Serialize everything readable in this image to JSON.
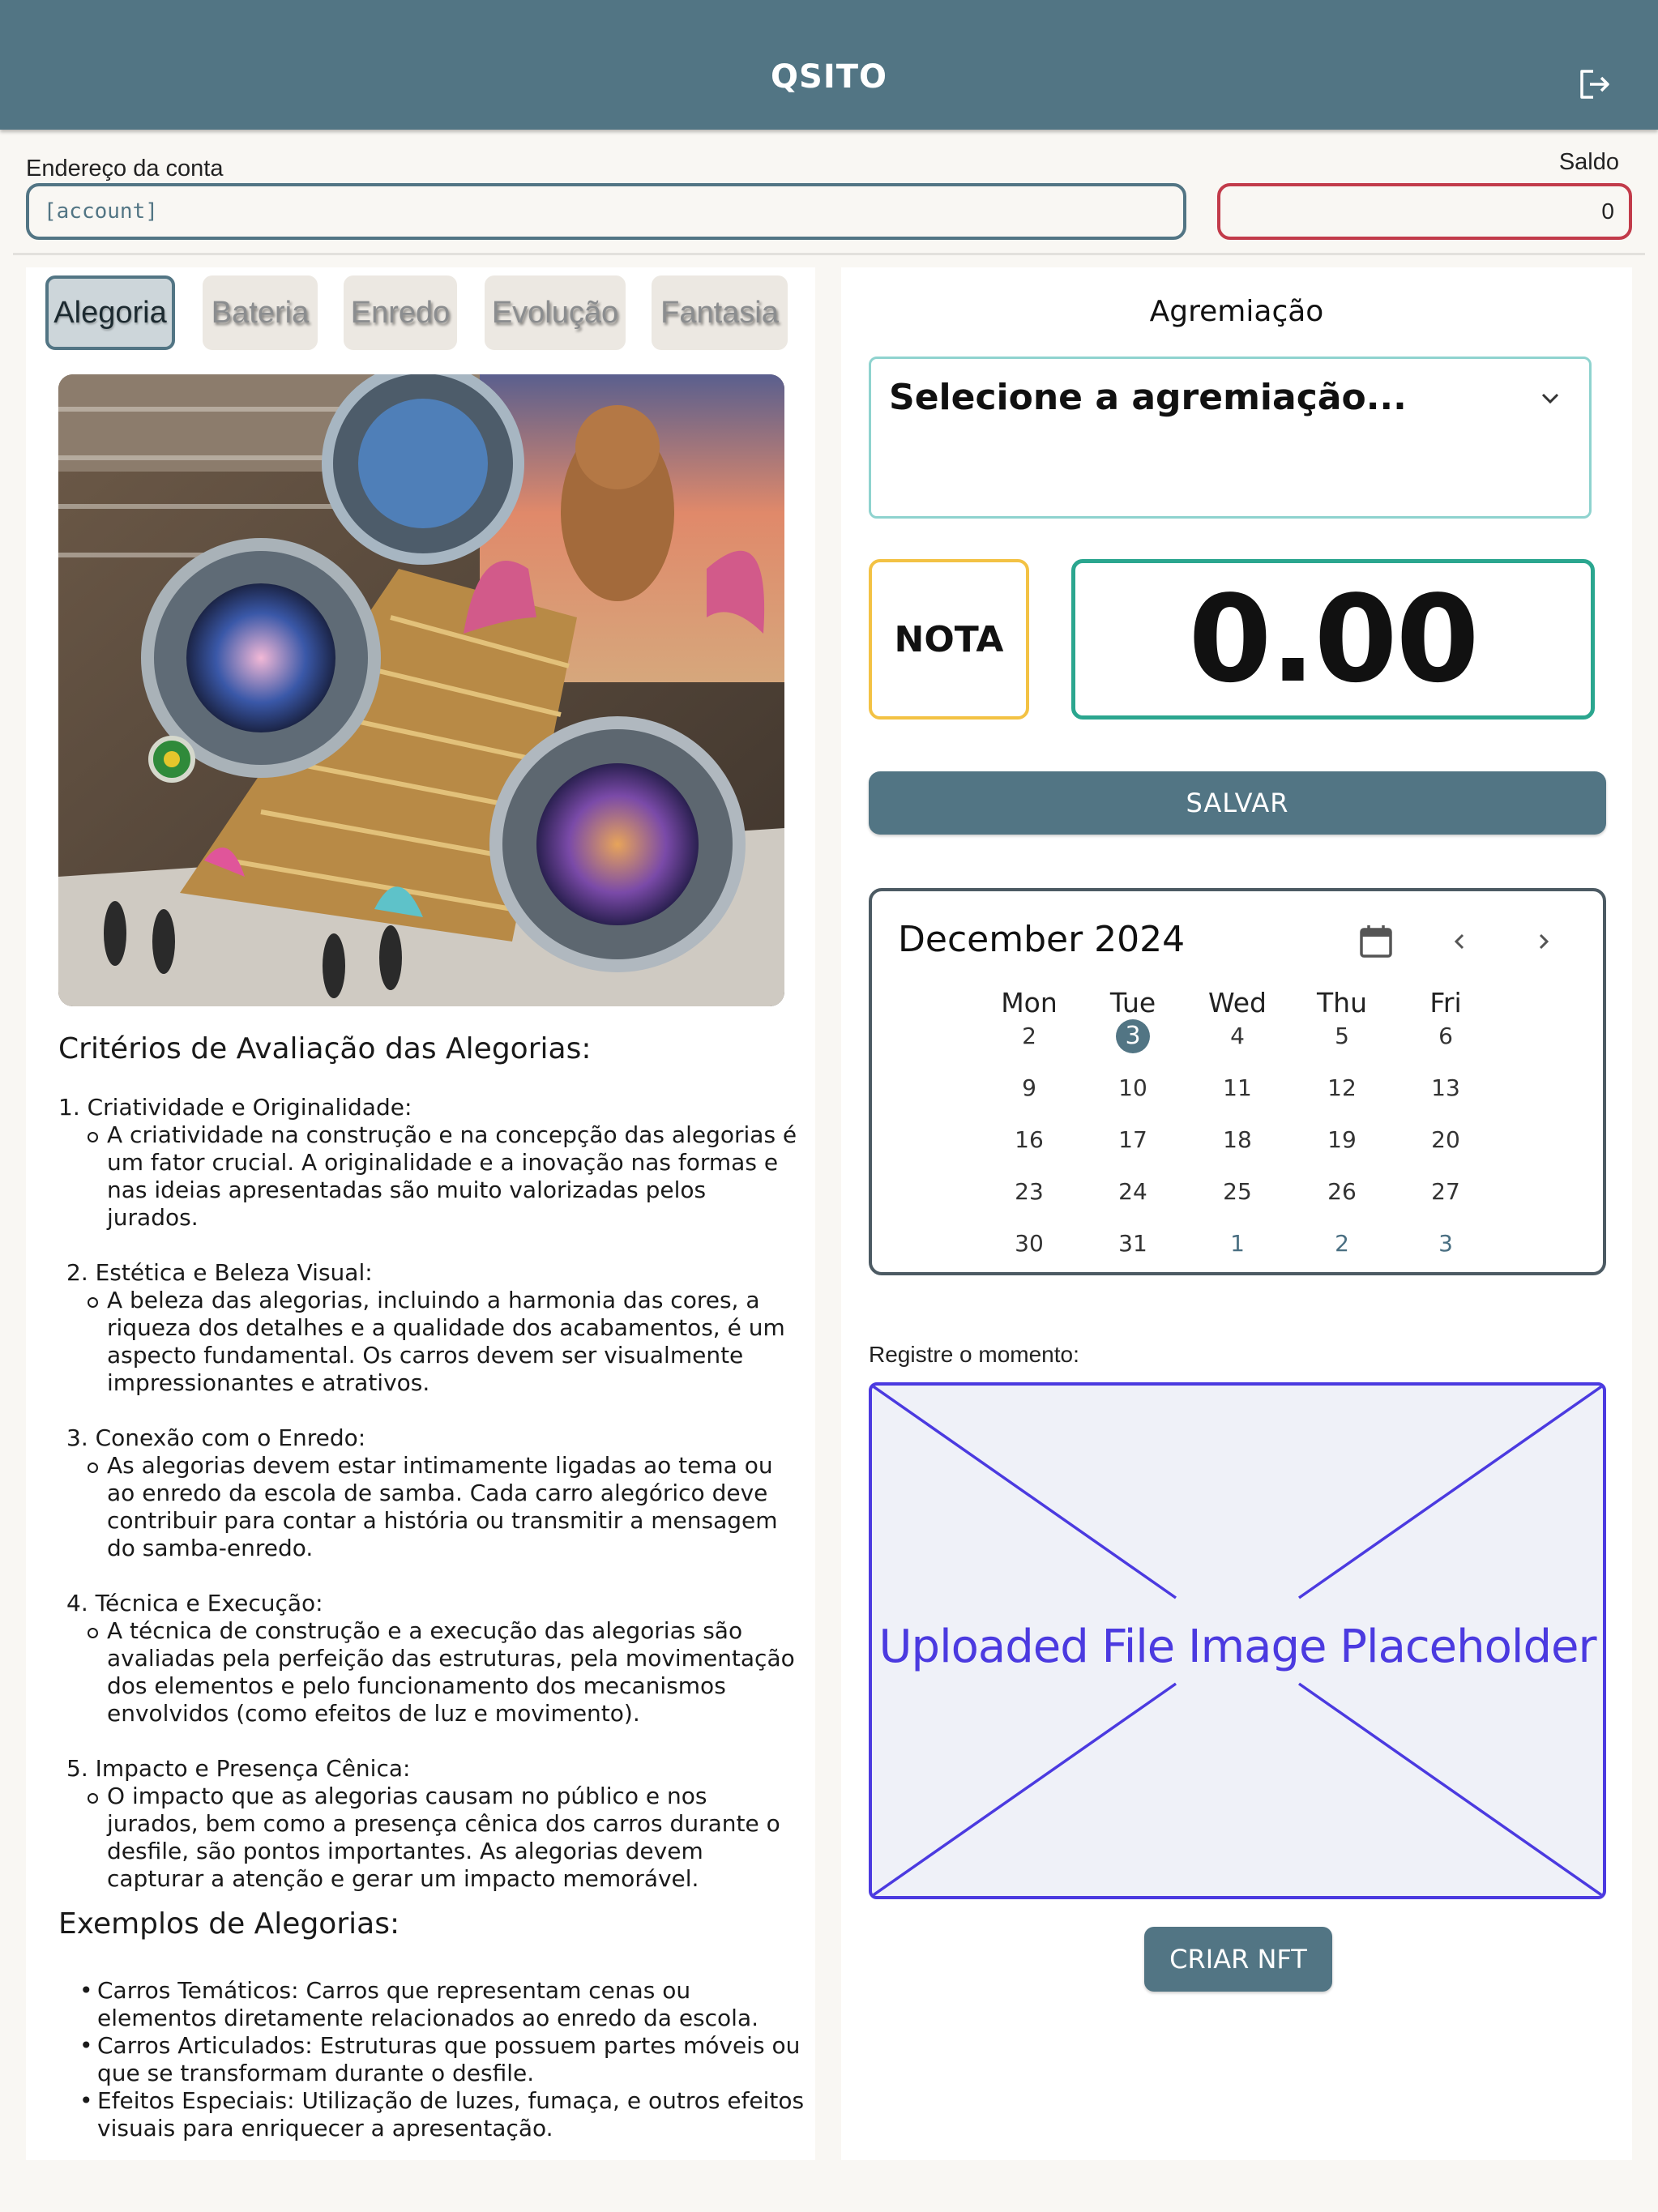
{
  "header": {
    "title": "QSITO",
    "logout_icon": "logout-icon"
  },
  "account": {
    "label": "Endereço da conta",
    "value": "[account]"
  },
  "saldo": {
    "label": "Saldo",
    "value": "0"
  },
  "tabs": [
    {
      "label": "Alegoria",
      "active": true
    },
    {
      "label": "Bateria",
      "active": false
    },
    {
      "label": "Enredo",
      "active": false
    },
    {
      "label": "Evolução",
      "active": false
    },
    {
      "label": "Fantasia",
      "active": false
    }
  ],
  "content": {
    "criteria_title": "Critérios de Avaliação das Alegorias:",
    "criteria": [
      {
        "title": "1. Criatividade e Originalidade:",
        "desc": "A criatividade na construção e na concepção das alegorias é um fator crucial. A originalidade e a inovação nas formas e nas ideias apresentadas são muito valorizadas pelos jurados."
      },
      {
        "title": "2. Estética e Beleza Visual:",
        "desc": "A beleza das alegorias, incluindo a harmonia das cores, a riqueza dos detalhes e a qualidade dos acabamentos, é um aspecto fundamental. Os carros devem ser visualmente impressionantes e atrativos."
      },
      {
        "title": "3. Conexão com o Enredo:",
        "desc": "As alegorias devem estar intimamente ligadas ao tema ou ao enredo da escola de samba. Cada carro alegórico deve contribuir para contar a história ou transmitir a mensagem do samba-enredo."
      },
      {
        "title": "4. Técnica e Execução:",
        "desc": "A técnica de construção e a execução das alegorias são avaliadas pela perfeição das estruturas, pela movimentação dos elementos e pelo funcionamento dos mecanismos envolvidos (como efeitos de luz e movimento)."
      },
      {
        "title": "5. Impacto e Presença Cênica:",
        "desc": "O impacto que as alegorias causam no público e nos jurados, bem como a presença cênica dos carros durante o desfile, são pontos importantes. As alegorias devem capturar a atenção e gerar um impacto memorável."
      }
    ],
    "examples_title": "Exemplos de Alegorias:",
    "examples": [
      "Carros Temáticos: Carros que representam cenas ou elementos diretamente relacionados ao enredo da escola.",
      "Carros Articulados: Estruturas que possuem partes móveis ou que se transformam durante o desfile.",
      "Efeitos Especiais: Utilização de luzes, fumaça, e outros efeitos visuais para enriquecer a apresentação."
    ]
  },
  "agremiacao": {
    "label": "Agremiação",
    "placeholder": "Selecione a agremiação...",
    "icon": "chevron-down-icon"
  },
  "nota": {
    "label": "NOTA",
    "value": "0.00"
  },
  "salvar_label": "SALVAR",
  "calendar": {
    "title": "December 2024",
    "headers": [
      "Mon",
      "Tue",
      "Wed",
      "Thu",
      "Fri"
    ],
    "weeks": [
      [
        "2",
        "3",
        "4",
        "5",
        "6"
      ],
      [
        "9",
        "10",
        "11",
        "12",
        "13"
      ],
      [
        "16",
        "17",
        "18",
        "19",
        "20"
      ],
      [
        "23",
        "24",
        "25",
        "26",
        "27"
      ],
      [
        "30",
        "31",
        "1",
        "2",
        "3"
      ]
    ],
    "selected": "3",
    "icons": {
      "calendar": "calendar-icon",
      "prev": "chevron-left-icon",
      "next": "chevron-right-icon"
    }
  },
  "moment": {
    "label": "Registre o momento:",
    "placeholder_text": "Uploaded File Image Placeholder"
  },
  "nft_label": "CRIAR NFT",
  "colors": {
    "primary": "#527584",
    "saldo_border": "#c23b4a",
    "nota_border": "#f3c244",
    "score_border": "#2ba68f",
    "select_border": "#8fd3cf",
    "upload_accent": "#4b3ae0"
  }
}
